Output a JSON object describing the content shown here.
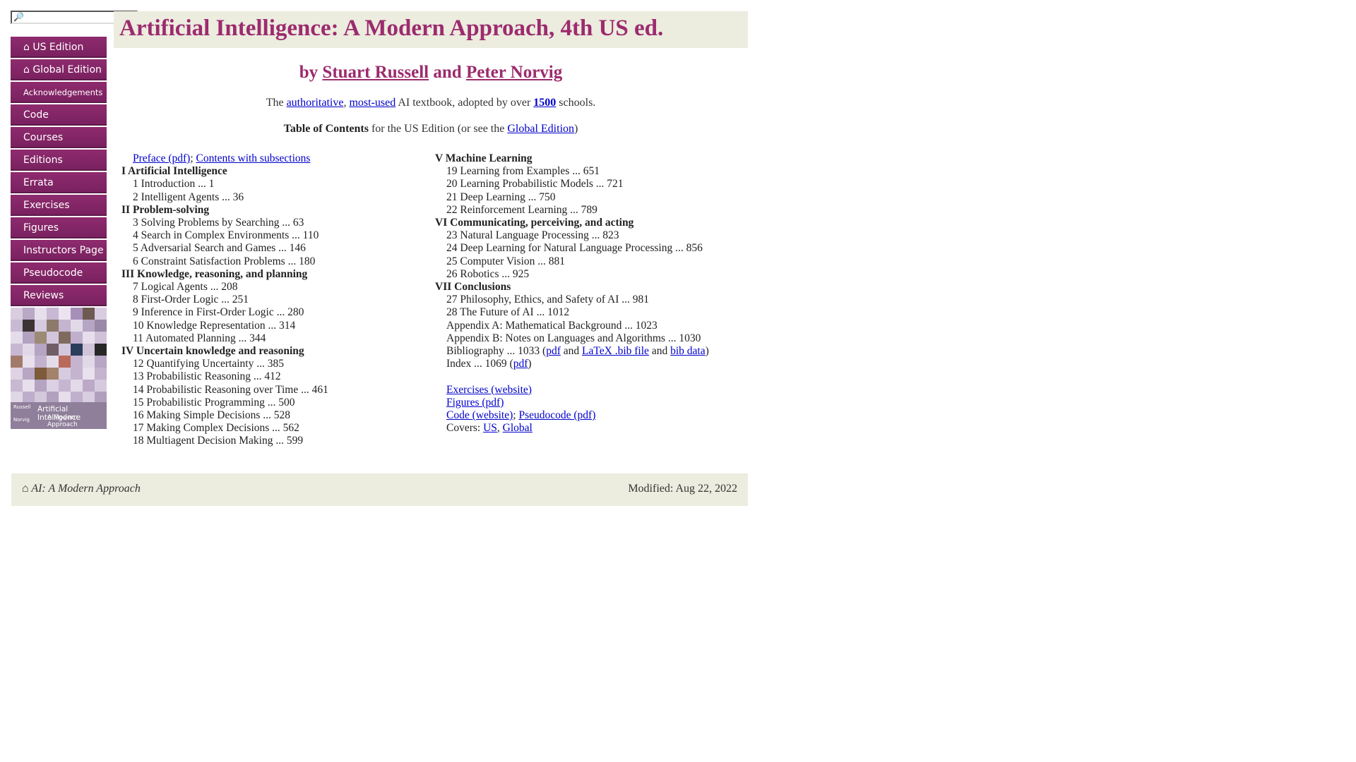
{
  "search": {
    "placeholder": "",
    "icon": "magnifier-icon"
  },
  "sidebar": {
    "items": [
      {
        "label": "⌂ US Edition"
      },
      {
        "label": "⌂ Global Edition"
      },
      {
        "label": "Acknowledgements"
      },
      {
        "label": "Code"
      },
      {
        "label": "Courses"
      },
      {
        "label": "Editions"
      },
      {
        "label": "Errata"
      },
      {
        "label": "Exercises"
      },
      {
        "label": "Figures"
      },
      {
        "label": "Instructors Page"
      },
      {
        "label": "Pseudocode"
      },
      {
        "label": "Reviews"
      }
    ],
    "cover": {
      "title": "Artificial Intelligence",
      "subtitle": "A Modern Approach",
      "authors": [
        "Russell",
        "Norvig"
      ]
    }
  },
  "header": {
    "title": "Artificial Intelligence: A Modern Approach, 4th US ed.",
    "by": "by",
    "author1": "Stuart Russell",
    "and": "and",
    "author2": "Peter Norvig"
  },
  "tagline": {
    "the": "The",
    "link1": "authoritative",
    "comma": ",",
    "link2": "most-used",
    "middle": "AI textbook, adopted by over",
    "link3": "1500",
    "end": "schools."
  },
  "toc_heading": {
    "bold": "Table of Contents",
    "text": "for the US Edition (or see the",
    "link": "Global Edition",
    "close": ")"
  },
  "toc_left": {
    "preface_link": "Preface (pdf)",
    "sep": ";",
    "contents_link": "Contents with subsections",
    "lines": [
      {
        "part": "I Artificial Intelligence"
      },
      {
        "ch": "1 Introduction ... 1"
      },
      {
        "ch": "2 Intelligent Agents ... 36"
      },
      {
        "part": "II Problem-solving"
      },
      {
        "ch": "3 Solving Problems by Searching ... 63"
      },
      {
        "ch": "4 Search in Complex Environments ... 110"
      },
      {
        "ch": "5 Adversarial Search and Games ... 146"
      },
      {
        "ch": "6 Constraint Satisfaction Problems ... 180"
      },
      {
        "part": "III Knowledge, reasoning, and planning"
      },
      {
        "ch": "7 Logical Agents ... 208"
      },
      {
        "ch": "8 First-Order Logic ... 251"
      },
      {
        "ch": "9 Inference in First-Order Logic ... 280"
      },
      {
        "ch": "10 Knowledge Representation ... 314"
      },
      {
        "ch": "11 Automated Planning ... 344"
      },
      {
        "part": "IV Uncertain knowledge and reasoning"
      },
      {
        "ch": "12 Quantifying Uncertainty ... 385"
      },
      {
        "ch": "13 Probabilistic Reasoning ... 412"
      },
      {
        "ch": "14 Probabilistic Reasoning over Time ... 461"
      },
      {
        "ch": "15 Probabilistic Programming ... 500"
      },
      {
        "ch": "16 Making Simple Decisions ... 528"
      },
      {
        "ch": "17 Making Complex Decisions ... 562"
      },
      {
        "ch": "18 Multiagent Decision Making ... 599"
      }
    ]
  },
  "toc_right": {
    "lines": [
      {
        "part": "V Machine Learning"
      },
      {
        "ch": "19 Learning from Examples ... 651"
      },
      {
        "ch": "20 Learning Probabilistic Models ... 721"
      },
      {
        "ch": "21 Deep Learning ... 750"
      },
      {
        "ch": "22 Reinforcement Learning ... 789"
      },
      {
        "part": "VI Communicating, perceiving, and acting"
      },
      {
        "ch": "23 Natural Language Processing ... 823"
      },
      {
        "ch": "24 Deep Learning for Natural Language Processing ... 856"
      },
      {
        "ch": "25 Computer Vision ... 881"
      },
      {
        "ch": "26 Robotics ... 925"
      },
      {
        "part": "VII Conclusions"
      },
      {
        "ch": "27 Philosophy, Ethics, and Safety of AI ... 981"
      },
      {
        "ch": "28 The Future of AI ... 1012"
      },
      {
        "ch": "Appendix A: Mathematical Background ... 1023"
      },
      {
        "ch": "Appendix B: Notes on Languages and Algorithms ... 1030"
      }
    ],
    "bibliography": {
      "text": "Bibliography ... 1033 (",
      "pdf": "pdf",
      "and1": "and",
      "bib": "LaTeX .bib file",
      "and2": "and",
      "bibdata": "bib data",
      "close": ")"
    },
    "index": {
      "text": "Index ... 1069 (",
      "pdf": "pdf",
      "close": ")"
    },
    "resources": {
      "exercises": "Exercises (website)",
      "figures": "Figures (pdf)",
      "code": "Code (website)",
      "sep": ";",
      "pseudocode": "Pseudocode (pdf)",
      "covers_label": "Covers:",
      "covers_us": "US",
      "covers_comma": ",",
      "covers_global": "Global"
    }
  },
  "footer": {
    "home": "⌂ AI: A Modern Approach",
    "modified": "Modified: Aug 22, 2022"
  },
  "colors": {
    "title": "#9c2b6e",
    "nav_bg": "#7f2463",
    "bar_bg": "#ececdf",
    "link": "#0000cc"
  }
}
